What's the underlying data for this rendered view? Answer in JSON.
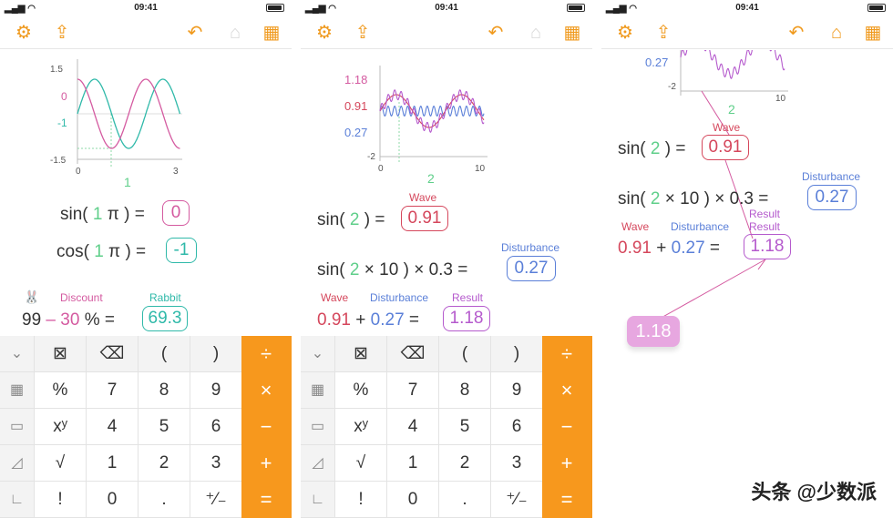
{
  "status": {
    "time": "09:41"
  },
  "colors": {
    "accent": "#f7981d",
    "wave": "#d5475c",
    "disturbance": "#5a7fd8",
    "result": "#b55acd",
    "rabbit": "#2fb9a9"
  },
  "toolbar_icons": [
    "gear-icon",
    "share-icon",
    "undo-icon",
    "tag-icon",
    "calculator-icon"
  ],
  "screen1": {
    "chart": {
      "y_ticks": [
        "1.5",
        "0",
        "-1",
        "-1.5"
      ],
      "x_ticks": [
        "0",
        "3"
      ],
      "x_marker": "1"
    },
    "sin_line": {
      "func": "sin(",
      "arg": "1",
      "pi": "π",
      "close": ")",
      "eq": "=",
      "result": "0"
    },
    "cos_line": {
      "func": "cos(",
      "arg": "1",
      "pi": "π",
      "close": ")",
      "eq": "=",
      "result": "-1"
    },
    "discount": {
      "rabbit_emoji": "🐰",
      "label_discount": "Discount",
      "label_rabbit": "Rabbit",
      "a": "99",
      "minus": "–",
      "b": "30",
      "pct": "%",
      "eq": "=",
      "result": "69.3"
    }
  },
  "screen2": {
    "chart": {
      "y_ticks": [
        "1.18",
        "0.91",
        "0.27",
        "-2"
      ],
      "x_ticks": [
        "0",
        "10"
      ],
      "x_marker": "2"
    },
    "line1": {
      "func": "sin(",
      "arg": "2",
      "close": ")",
      "eq": "=",
      "label": "Wave",
      "result": "0.91"
    },
    "line2": {
      "func": "sin(",
      "arg": "2",
      "times": "×",
      "n": "10",
      "close": ")",
      "times2": "×",
      "k": "0.3",
      "eq": "=",
      "label": "Disturbance",
      "result": "0.27"
    },
    "line3": {
      "l1": "Wave",
      "l2": "Disturbance",
      "l3": "Result",
      "a": "0.91",
      "plus": "+",
      "b": "0.27",
      "eq": "=",
      "result": "1.18"
    }
  },
  "screen3": {
    "chart": {
      "y_ticks": [
        "0.27",
        "-2"
      ],
      "x_ticks": [
        "2",
        "10"
      ]
    },
    "line1": {
      "func": "sin(",
      "arg": "2",
      "close": ")",
      "eq": "=",
      "label": "Wave",
      "result": "0.91"
    },
    "line2": {
      "func": "sin(",
      "arg": "2",
      "times": "×",
      "n": "10",
      "close": ")",
      "times2": "×",
      "k": "0.3",
      "eq": "=",
      "label": "Disturbance",
      "result": "0.27"
    },
    "line3": {
      "l1": "Wave",
      "l2": "Disturbance",
      "l3": "Result",
      "l3b": "Result",
      "a": "0.91",
      "plus": "+",
      "b": "0.27",
      "eq": "=",
      "result": "1.18"
    },
    "drag_bubble": "1.18"
  },
  "keypad": {
    "rows": [
      [
        "⌄",
        "⊠",
        "⌫",
        "(",
        ")",
        "÷"
      ],
      [
        "▦",
        "%",
        "7",
        "8",
        "9",
        "×"
      ],
      [
        "▭",
        "xʸ",
        "4",
        "5",
        "6",
        "−"
      ],
      [
        "◿",
        "√",
        "1",
        "2",
        "3",
        "+"
      ],
      [
        "∟",
        "!",
        "0",
        ".",
        "⁺⁄₋",
        "="
      ]
    ]
  },
  "watermark": "头条 @少数派"
}
